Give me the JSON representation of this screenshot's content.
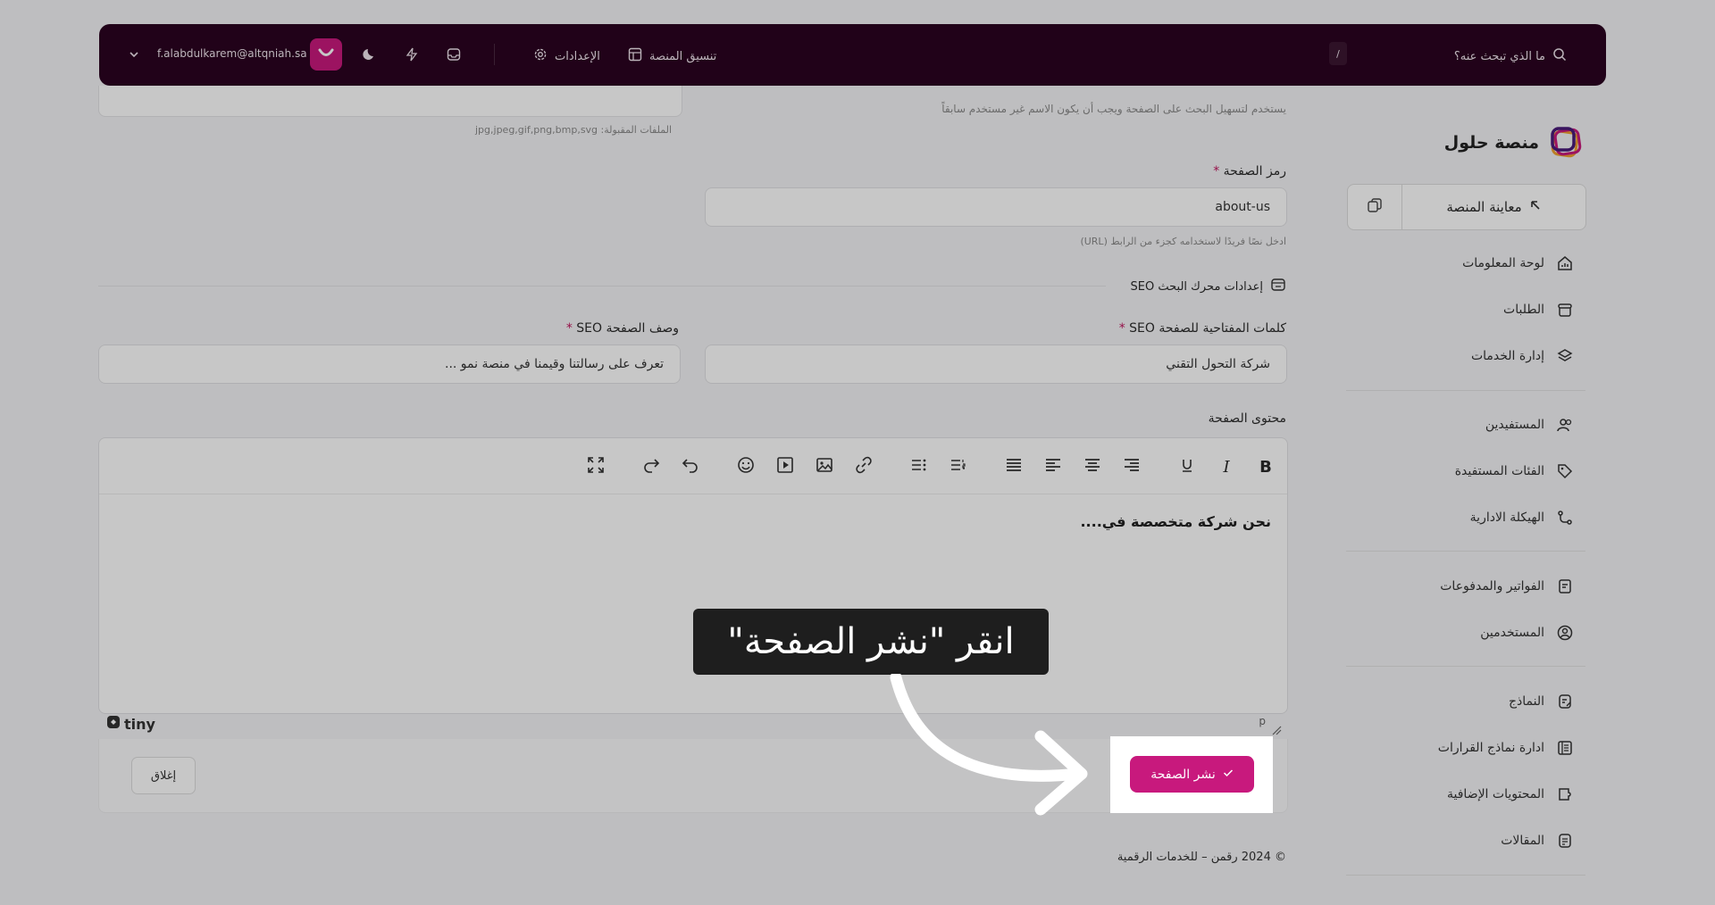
{
  "topbar": {
    "search_placeholder": "ما الذي تبحث عنه؟",
    "search_shortcut": "/",
    "platform_coord": "تنسيق المنصة",
    "settings": "الإعدادات",
    "user_email": "f.alabdulkarem@altqniah.sa"
  },
  "sidebar": {
    "brand": "منصة حلول",
    "preview": "معاينة المنصة",
    "group1": [
      "لوحة المعلومات",
      "الطلبات",
      "إدارة الخدمات"
    ],
    "group2": [
      "المستفيدين",
      "الفئات المستفيدة",
      "الهيكلة الادارية"
    ],
    "group3": [
      "الفواتير والمدفوعات",
      "المستخدمين"
    ],
    "group4": [
      "النماذج",
      "ادارة نماذج القرارات",
      "المحتويات الإضافية",
      "المقالات"
    ]
  },
  "form": {
    "top_hint": "يستخدم لتسهيل البحث على الصفحة ويجب أن يكون الاسم غير مستخدم سابقاً",
    "accepted_files": "الملفات المقبولة: jpg,jpeg,gif,png,bmp,svg",
    "slug_label": "رمز الصفحة",
    "slug_value": "about-us",
    "slug_hint": "ادخل نصًا فريدًا لاستخدامه كجزء من الرابط (URL)",
    "seo_section": "إعدادات محرك البحث SEO",
    "keywords_label": "كلمات المفتاحية للصفحة SEO",
    "keywords_value": "شركة التحول التقني",
    "desc_label": "وصف الصفحة SEO",
    "desc_value": "تعرف على رسالتنا وقيمنا في منصة نمو ...",
    "content_label": "محتوى الصفحة",
    "editor_text": "نحن شركة متخصصة في....",
    "editor_path": "p",
    "tiny": "tiny",
    "close": "إغلاق",
    "publish": "نشر الصفحة",
    "required_mark": "*"
  },
  "footer": "© 2024 رقمن – للخدمات الرقمية",
  "callout": "انقر \"نشر الصفحة\"",
  "colors": {
    "brand": "#c8197d",
    "topbar": "#2b0320"
  }
}
